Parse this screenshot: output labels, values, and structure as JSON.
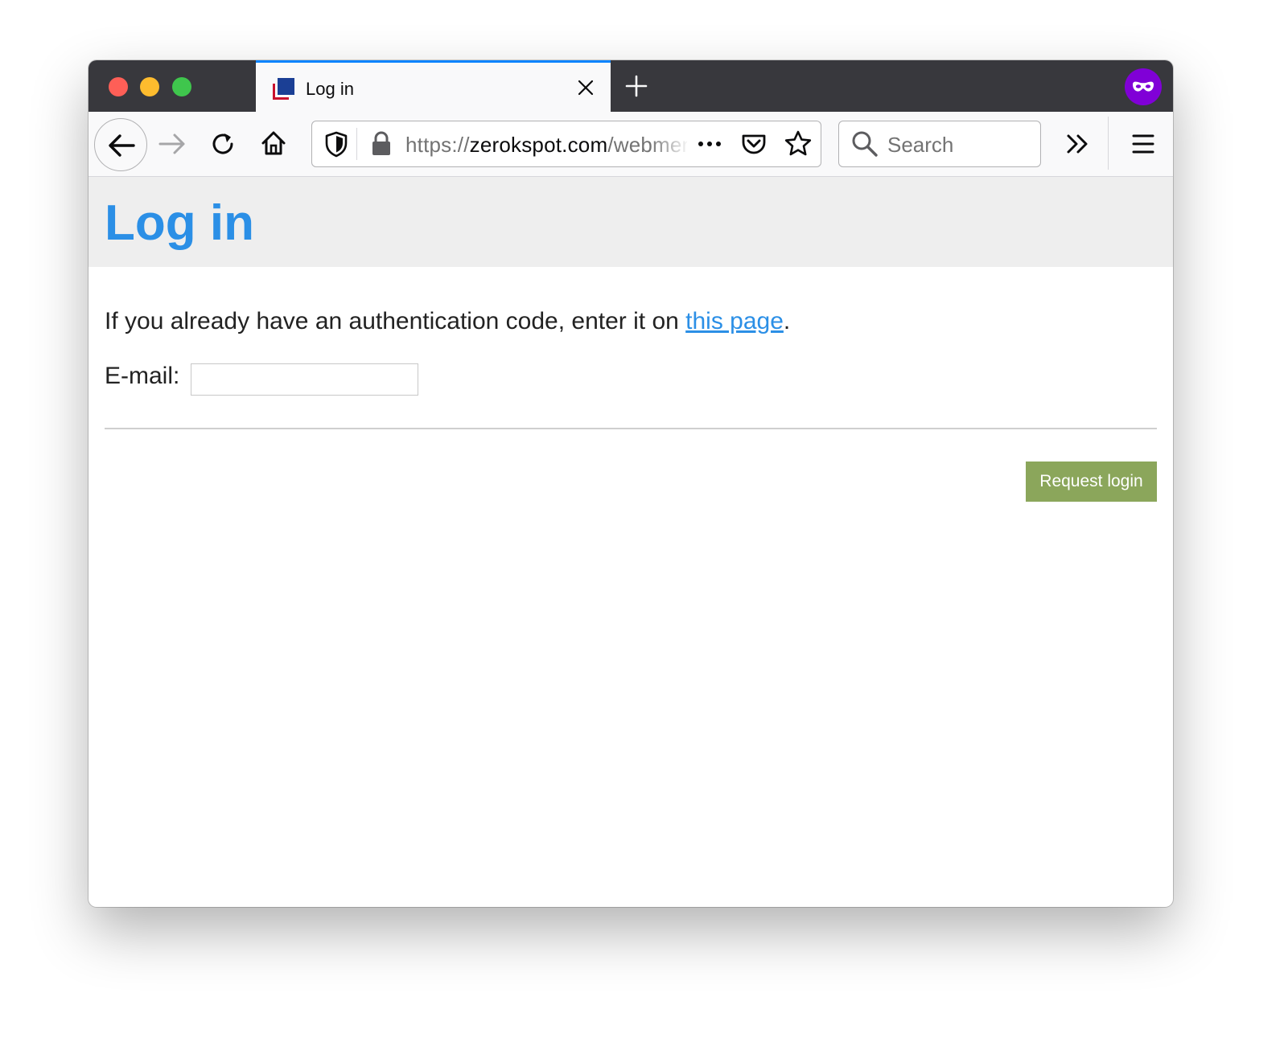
{
  "tab": {
    "title": "Log in",
    "close_icon": "close-icon",
    "favicon": "site-favicon"
  },
  "toolbar": {
    "back_icon": "back-arrow-icon",
    "forward_icon": "forward-arrow-icon",
    "reload_icon": "reload-icon",
    "home_icon": "home-icon",
    "new_tab_icon": "plus-icon",
    "private_icon": "private-browsing-mask-icon",
    "overflow_icon": "double-chevron-icon",
    "menu_icon": "hamburger-menu-icon"
  },
  "urlbar": {
    "scheme": "https://",
    "host": "zerokspot.com",
    "path": "/webmentions/",
    "shield_icon": "tracking-protection-shield-icon",
    "lock_icon": "lock-icon",
    "page_actions_icon": "more-dots-icon",
    "pocket_icon": "pocket-icon",
    "bookmark_icon": "star-icon"
  },
  "searchbar": {
    "placeholder": "Search",
    "icon": "search-icon"
  },
  "page": {
    "title": "Log in",
    "intro_before": "If you already have an authentication code, enter it on ",
    "intro_link": "this page",
    "intro_after": ".",
    "email_label": "E-mail:",
    "email_value": "",
    "submit_label": "Request login"
  },
  "colors": {
    "accent": "#2b8fe6",
    "button": "#8ba65b",
    "private": "#8000d7",
    "tab_highlight": "#0a84ff"
  }
}
